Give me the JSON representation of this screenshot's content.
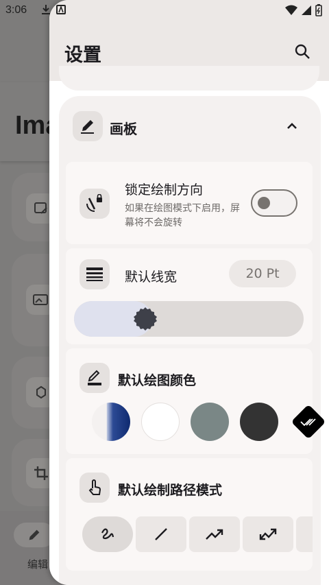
{
  "status_bar": {
    "time": "3:06"
  },
  "background_app": {
    "title_partial": "Ima",
    "bottom_nav_label_partial": "编辑"
  },
  "settings": {
    "title": "设置",
    "section": {
      "title": "画板",
      "lock_orientation": {
        "title": "锁定绘制方向",
        "description": "如果在绘图模式下启用，屏幕将不会旋转",
        "enabled": false
      },
      "line_width": {
        "title": "默认线宽",
        "value": "20 Pt",
        "slider_fraction": 0.28
      },
      "draw_color": {
        "title": "默认绘图颜色",
        "swatches": [
          "#1f3f86",
          "#ffffff",
          "#7a8786",
          "#333333",
          "#000000"
        ],
        "selected_index": 4
      },
      "path_mode": {
        "title": "默认绘制路径模式",
        "modes": [
          "freehand-icon",
          "line-icon",
          "arrow-icon",
          "double-arrow-icon"
        ],
        "selected_index": 0
      }
    }
  }
}
